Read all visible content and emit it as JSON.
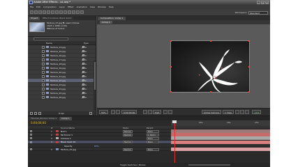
{
  "window": {
    "title": "Adobe After Effects - xx.aep *",
    "controls": [
      "_",
      "□",
      "×"
    ]
  },
  "menu": [
    "File",
    "Edit",
    "Composition",
    "Layer",
    "Effect",
    "Animation",
    "View",
    "Window",
    "Help"
  ],
  "toolbar": {
    "workspace_label": "Workspace:",
    "workspace_value": "Standard"
  },
  "project_panel": {
    "tabs": [
      "Project",
      "Effect Controls: Black Solid"
    ],
    "info": [
      "Texture_27.jpg ▼, used 2 times",
      "1920 x 1080 (1.00)",
      "",
      "Millions of Colors"
    ],
    "columns": {
      "name": "Name",
      "type": "Type"
    },
    "items": [
      {
        "name": "Texture_14.jpg",
        "type": "JPEG"
      },
      {
        "name": "Texture_15.jpg",
        "type": "JPEG"
      },
      {
        "name": "Texture_16.jpg",
        "type": "JPEG"
      },
      {
        "name": "Texture_17.jpg",
        "type": "JPEG"
      },
      {
        "name": "Texture_18.jpg",
        "type": "JPEG"
      },
      {
        "name": "Texture_19.jpg",
        "type": "JPEG"
      },
      {
        "name": "Texture_20.jpg",
        "type": "JPEG"
      },
      {
        "name": "Texture_21.jpg",
        "type": "JPEG"
      },
      {
        "name": "Texture_22.jpg",
        "type": "JPEG",
        "selected": true
      },
      {
        "name": "Texture_23.jpg",
        "type": "JPEG"
      },
      {
        "name": "Texture_24.jpg",
        "type": "JPEG"
      },
      {
        "name": "Texture_25.jpg",
        "type": "JPEG"
      },
      {
        "name": "Texture_26.jpg",
        "type": "JPEG"
      }
    ],
    "footer": {
      "bpc": "8 bpc"
    }
  },
  "comp_panel": {
    "tab": "Composition: Comp 1",
    "breadcrumb": "Comp 1",
    "controls": {
      "zoom": "50%",
      "timecode": "0;00;00;00",
      "resolution": "Half",
      "camera": "Active Camera",
      "views": "1 View",
      "exposure": "+0.0"
    }
  },
  "timeline": {
    "tabs": [
      {
        "label": "Flourish_09.mov Comp 1",
        "active": false
      },
      {
        "label": "Comp 1",
        "active": true
      }
    ],
    "timecode": "0;00;00;00",
    "columns": {
      "num": "#",
      "source": "Source Name",
      "mode": "Mode",
      "parent": "Parent"
    },
    "layers": [
      {
        "num": "1",
        "name": "Null 1",
        "color": "#c04040",
        "mode": "Normal",
        "parent": "None"
      },
      {
        "num": "2",
        "name": "Particular 1",
        "color": "#c04040",
        "mode": "Normal",
        "parent": "1. Null 1"
      },
      {
        "num": "3",
        "name": "Camera 1",
        "color": "#b0b0b0",
        "mode": "",
        "parent": "None"
      },
      {
        "num": "4",
        "name": "Black Solid 10",
        "color": "#c04040",
        "mode": "Normal",
        "parent": "None",
        "selected": true
      },
      {
        "num": "",
        "name": "Opacity",
        "value": "83%",
        "color": "",
        "mode": "",
        "parent": ""
      },
      {
        "num": "5",
        "name": "Texture_22.jpg",
        "color": "#7a8cc0",
        "mode": "Normal",
        "parent": "None"
      }
    ],
    "ruler_labels": [
      "0s",
      "05s",
      "10s",
      "15s"
    ],
    "footer_toggle": "Toggle Switches / Modes"
  }
}
